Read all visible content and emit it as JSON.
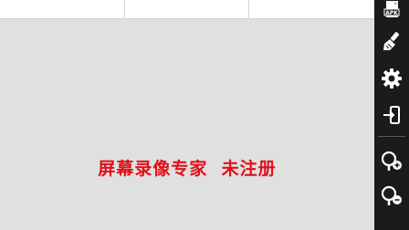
{
  "watermark": {
    "text": "屏幕录像专家  未注册",
    "color": "#e0101a"
  },
  "toolbar": {
    "background": "#1b1b1b",
    "icon_color": "#ffffff",
    "items": [
      {
        "icon": "apk-icon",
        "label": "APK"
      },
      {
        "icon": "broom-icon"
      },
      {
        "icon": "gear-icon"
      },
      {
        "icon": "exit-icon"
      },
      {
        "icon": "zoom-in-icon"
      },
      {
        "icon": "zoom-out-icon"
      }
    ]
  }
}
